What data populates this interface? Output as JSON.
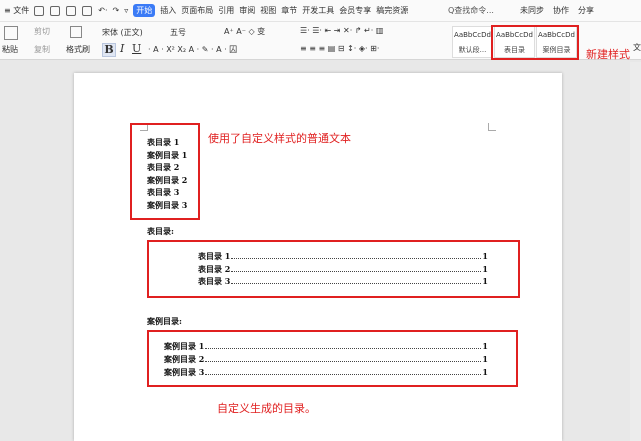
{
  "menubar": {
    "file": "≡ 文件",
    "items": [
      "开始",
      "插入",
      "页面布局",
      "引用",
      "审阅",
      "视图",
      "章节",
      "开发工具",
      "会员专享",
      "稿完资源"
    ],
    "search": "Q查找命令...",
    "right": [
      "未同步",
      "协作",
      "分享"
    ]
  },
  "ribbon": {
    "paste": "粘贴",
    "cut": "剪切",
    "copy": "复制",
    "format_painter": "格式刷",
    "font": "宋体 (正文)",
    "size": "五号",
    "styles": [
      {
        "preview": "AaBbCcDd",
        "name": "默认段..."
      },
      {
        "preview": "AaBbCcDd",
        "name": "表目录"
      },
      {
        "preview": "AaBbCcDd",
        "name": "案例目录"
      }
    ],
    "overflow": "文"
  },
  "annotations": {
    "new_style": "新建样式",
    "custom_style_text": "使用了自定义样式的普通文本",
    "custom_toc": "自定义生成的目录。"
  },
  "document": {
    "styled_lines": [
      "表目录 1",
      "案例目录 1",
      "表目录 2",
      "案例目录 2",
      "表目录 3",
      "案例目录 3"
    ],
    "table_heading": "表目录:",
    "table_toc": [
      {
        "label": "表目录 1",
        "page": "1"
      },
      {
        "label": "表目录 2",
        "page": "1"
      },
      {
        "label": "表目录 3",
        "page": "1"
      }
    ],
    "case_heading": "案例目录:",
    "case_toc": [
      {
        "label": "案例目录 1",
        "page": "1"
      },
      {
        "label": "案例目录 2",
        "page": "1"
      },
      {
        "label": "案例目录 3",
        "page": "1"
      }
    ]
  },
  "colors": {
    "accent": "#3b7bf6",
    "annotation": "#e02020"
  }
}
